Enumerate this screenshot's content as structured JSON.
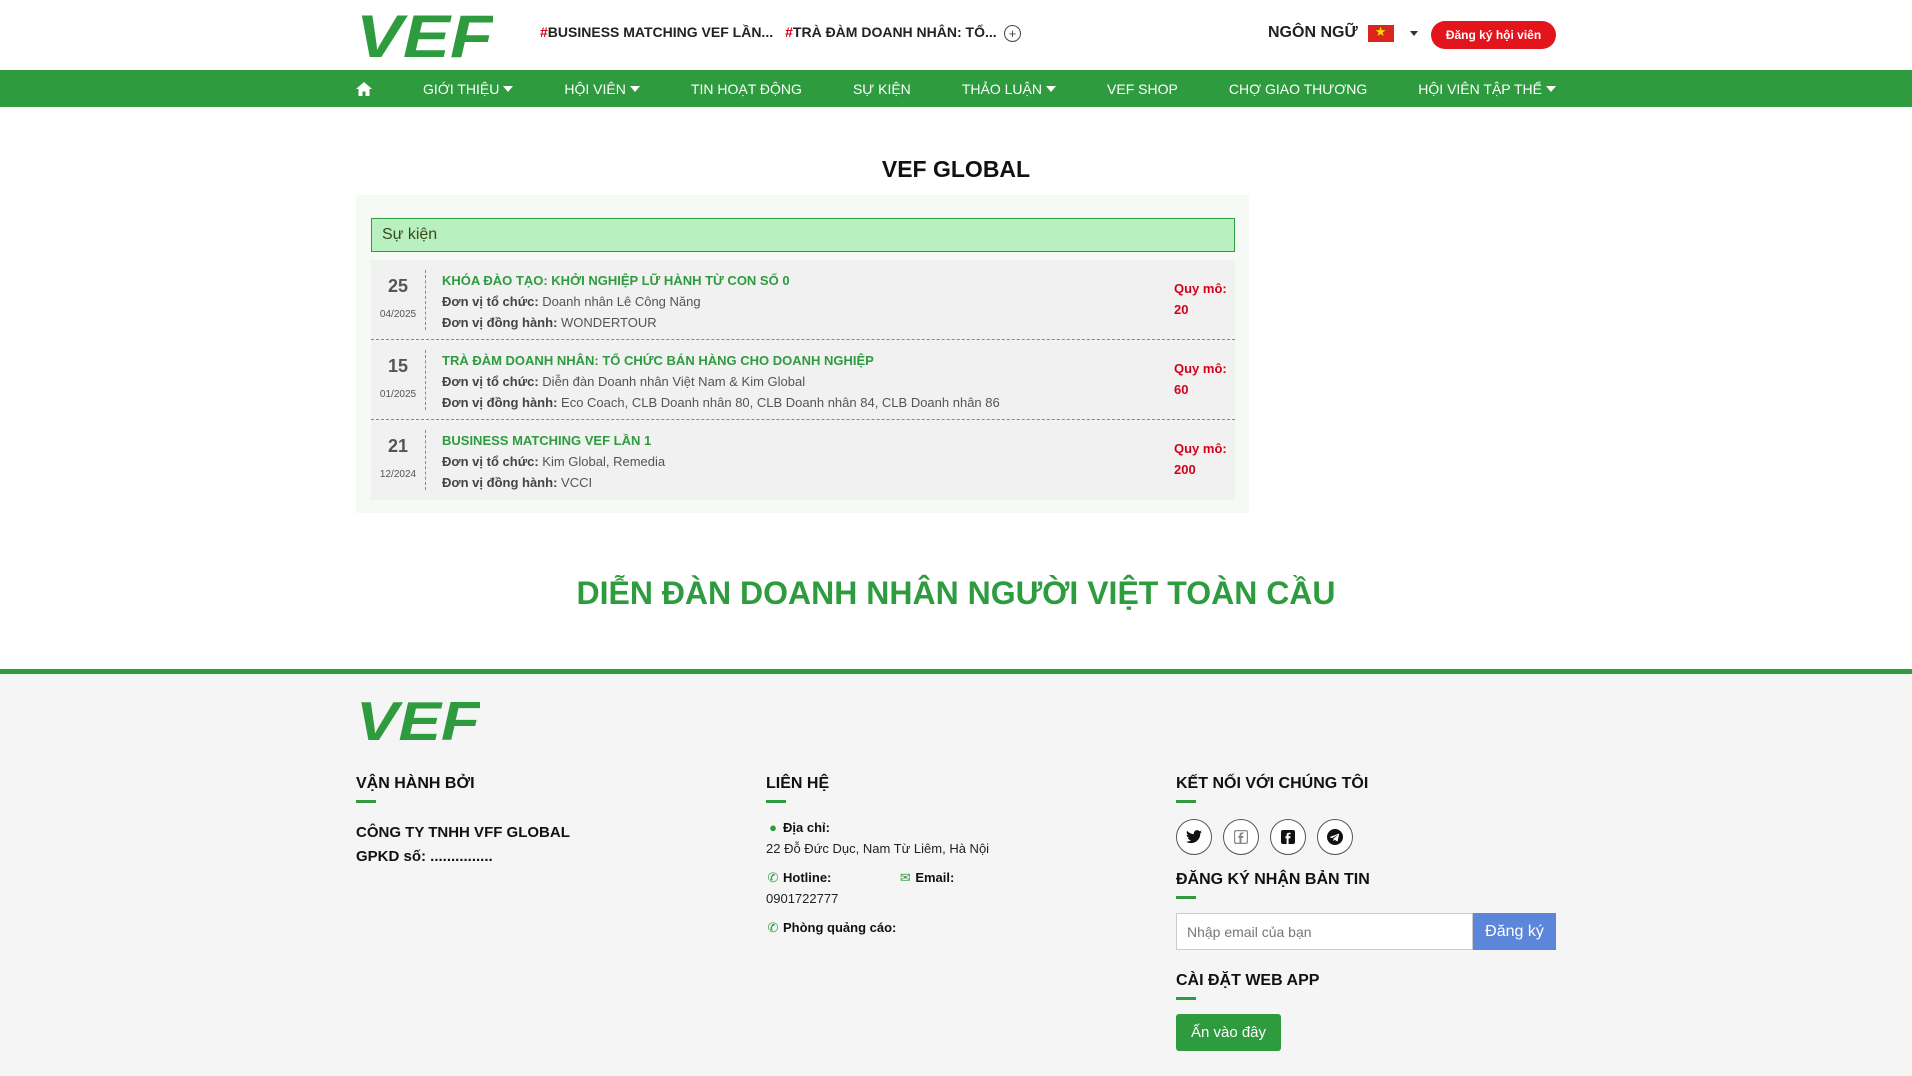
{
  "header": {
    "logo_text": "VEF",
    "ticker": [
      {
        "hash": "#",
        "text": "BUSINESS MATCHING VEF LẦN..."
      },
      {
        "hash": "#",
        "text": "TRÀ ĐÀM DOANH NHÂN: TỔ..."
      }
    ],
    "ticker_more": "+",
    "language_label": "NGÔN NGỮ",
    "register_label": "Đăng ký hội viên"
  },
  "nav": {
    "items": [
      {
        "label": "GIỚI THIỆU"
      },
      {
        "label": "HỘI VIÊN"
      },
      {
        "label": "TIN HOẠT ĐỘNG"
      },
      {
        "label": "SỰ KIỆN"
      },
      {
        "label": "THẢO LUẬN"
      },
      {
        "label": "VEF SHOP"
      },
      {
        "label": "CHỢ GIAO THƯƠNG"
      },
      {
        "label": "HỘI VIÊN TẬP THỂ"
      }
    ]
  },
  "main": {
    "title": "VEF GLOBAL",
    "events_header": "Sự kiện",
    "organizer_label": "Đơn vị tổ chức:",
    "partner_label": "Đơn vị đồng hành:",
    "scale_label": "Quy mô:",
    "events": [
      {
        "day": "25",
        "month": "04/2025",
        "title": "KHÓA ĐÀO TẠO: KHỞI NGHIỆP LỮ HÀNH TỪ CON SỐ 0",
        "organizer": "Doanh nhân Lê Công Năng",
        "partner": "WONDERTOUR",
        "scale": "20"
      },
      {
        "day": "15",
        "month": "01/2025",
        "title": "TRÀ ĐÀM DOANH NHÂN: TỔ CHỨC BÁN HÀNG CHO DOANH NGHIỆP",
        "organizer": "Diễn đàn Doanh nhân Việt Nam & Kim Global",
        "partner": "Eco Coach, CLB Doanh nhân 80, CLB Doanh nhân 84, CLB Doanh nhân 86",
        "scale": "60"
      },
      {
        "day": "21",
        "month": "12/2024",
        "title": "BUSINESS MATCHING VEF LẦN 1",
        "organizer": "Kim Global, Remedia",
        "partner": "VCCI",
        "scale": "200"
      }
    ],
    "slogan": "DIỄN ĐÀN DOANH NHÂN NGƯỜI VIỆT TOÀN CẦU"
  },
  "footer": {
    "logo_text": "VEF",
    "operated_heading": "VẬN HÀNH BỞI",
    "company_name": "CÔNG TY TNHH VFF GLOBAL",
    "license": "GPKD số: ...............",
    "contact_heading": "LIÊN HỆ",
    "address_label": "Địa chỉ:",
    "address": "22 Đỗ Đức Dục, Nam Từ Liêm, Hà Nội",
    "hotline_label": "Hotline:",
    "hotline": "0901722777",
    "email_label": "Email:",
    "ads_label": "Phòng quảng cáo:",
    "connect_heading": "KẾT NỐI VỚI CHÚNG TÔI",
    "newsletter_heading": "ĐĂNG KÝ NHẬN BẢN TIN",
    "email_placeholder": "Nhập email của bạn",
    "subscribe_label": "Đăng ký",
    "webapp_heading": "CÀI ĐẶT WEB APP",
    "webapp_button": "Ấn vào đây"
  },
  "colors": {
    "brand_green": "#2e9b3e",
    "accent_red": "#e3141c",
    "subscribe_blue": "#5b86d9"
  }
}
